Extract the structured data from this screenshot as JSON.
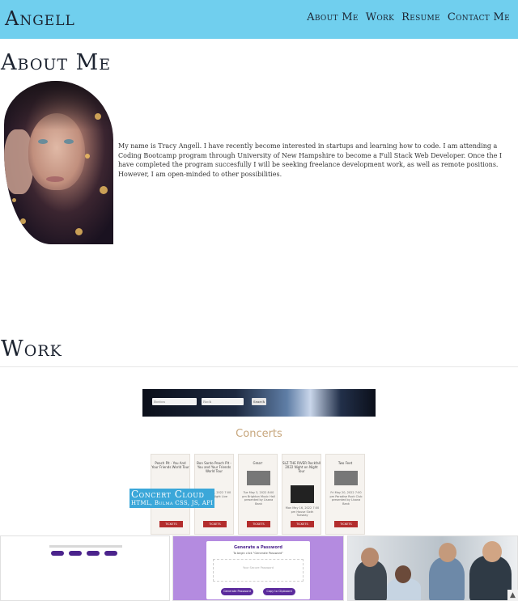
{
  "nav": {
    "brand": "Angell",
    "links": [
      "About Me",
      "Work",
      "Resume",
      "Contact Me"
    ]
  },
  "about": {
    "heading": "About Me",
    "bio": "My name is Tracy Angell. I have recently become interested in startups and learning how to code. I am attending a Coding Bootcamp program through University of New Hampshire to become a Full Stack Web Developer. Once the I have completed the program succesfully I will be seeking freelance development work, as well as remote positions. However, I am open-minded to other possibilities."
  },
  "work": {
    "heading": "Work",
    "featured": {
      "title": "Concert Cloud",
      "tech": "HTML, Bulma CSS, JS, API",
      "screenshot": {
        "search_placeholder": "Boston",
        "select_value": "Rock",
        "search_button": "Search",
        "heading": "Concerts",
        "cards": [
          {
            "title": "Peach Pit - You And Your Friends World Tour",
            "info": "Tue May 31, 2022 7:00 pm Big Night Live",
            "button": "TICKETS"
          },
          {
            "title": "Bon Santo Peach Pit - You and Your Friends World Tour",
            "info": "Wed May 4, 2022 7:00 pm Big Night Live",
            "button": "TICKETS"
          },
          {
            "title": "Grват",
            "info": "Tue May 3, 2022 8:00 pm Brighton Music Hall presented by Lisana Bank",
            "button": "TICKETS"
          },
          {
            "title": "SLZ THE RIVER Rockfall 2022 Night on Night Tour",
            "info": "Mon May 16, 2022 7:00 pm House Sixth Tuesday",
            "button": "TICKETS"
          },
          {
            "title": "Two Feet",
            "info": "Fri May 20, 2022 7:00 pm Paradise Rock Club presented by Lisana Bank",
            "button": "TICKETS"
          }
        ]
      }
    },
    "thumbnails": [
      {
        "name": "quiz-app"
      },
      {
        "name": "password-generator",
        "title": "Generate a Password",
        "subtitle": "To begin click \"Generate Password\"",
        "placeholder": "Your Secure Password",
        "buttons": [
          "Generate Password",
          "Copy to Clipboard"
        ]
      },
      {
        "name": "team-photo"
      }
    ]
  },
  "colors": {
    "navbar": "#70cfee",
    "label": "#3ba7d9",
    "accent_purple": "#4b238c",
    "ticket_red": "#b32d2d"
  },
  "icons": {
    "scroll_up": "▲"
  }
}
